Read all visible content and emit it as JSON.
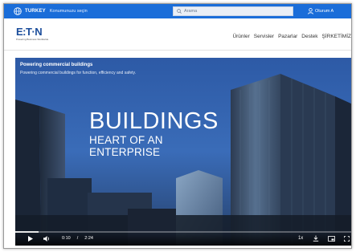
{
  "topbar": {
    "country": "TURKEY",
    "location_link": "Konumunuzu seçin",
    "search_placeholder": "Arama",
    "login_label": "Oturum A"
  },
  "header": {
    "logo_text": "E:T·N",
    "logo_tagline": "Powering Business Worldwide",
    "nav": [
      "Ürünler",
      "Servisler",
      "Pazarlar",
      "Destek",
      "ŞİRKETİMİZ"
    ]
  },
  "video": {
    "title": "Powering commercial buildings",
    "subtitle": "Powering commercial buildings for function, efficiency and safety.",
    "headline_big": "BUILDINGS",
    "headline_line1": "HEART OF AN",
    "headline_line2": "ENTERPRISE",
    "current_time": "0:10",
    "separator": "/",
    "duration": "2:24",
    "progress_fraction": 0.07,
    "speed": "1x"
  },
  "colors": {
    "topbar": "#1a6dd9",
    "logo": "#1b4d9b"
  }
}
